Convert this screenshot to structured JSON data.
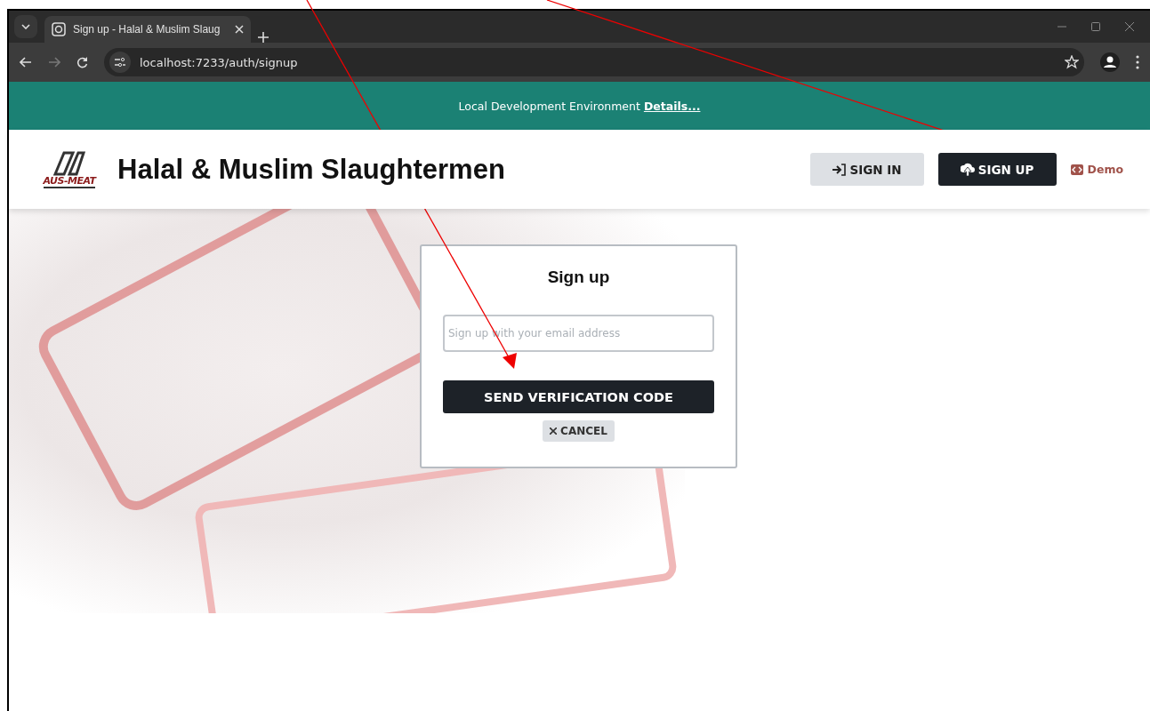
{
  "browser": {
    "tab_title": "Sign up - Halal & Muslim Slaug",
    "url": "localhost:7233/auth/signup"
  },
  "banner": {
    "text": "Local Development Environment",
    "link": "Details..."
  },
  "header": {
    "logo_text": "AUS-MEAT",
    "title": "Halal & Muslim Slaughtermen",
    "buttons": [
      {
        "label": "SIGN IN",
        "kind": "signin"
      },
      {
        "label": "SIGN UP",
        "kind": "signup"
      }
    ],
    "demo": "Demo"
  },
  "signup_card": {
    "title": "Sign up",
    "email": {
      "placeholder": "Sign up with your email address"
    },
    "submit": "SEND VERIFICATION CODE",
    "cancel": "CANCEL"
  }
}
